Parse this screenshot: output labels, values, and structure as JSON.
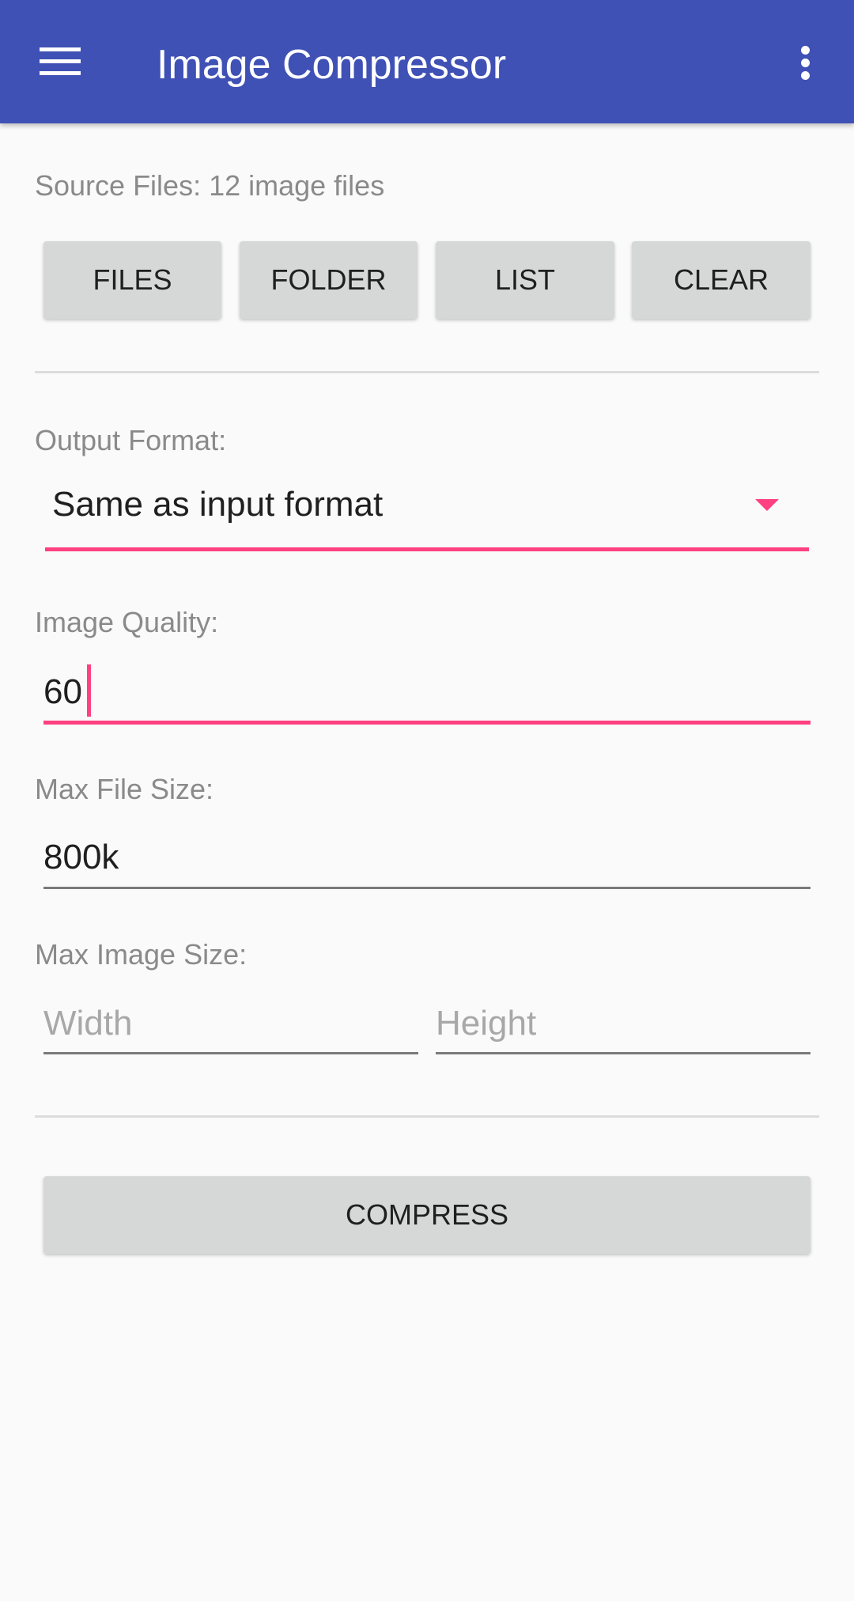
{
  "app_bar": {
    "title": "Image Compressor",
    "menu_icon": "hamburger-menu-icon",
    "overflow_icon": "more-vert-icon",
    "color": "#3f51b5"
  },
  "source": {
    "label": "Source Files: 12 image files",
    "buttons": [
      {
        "label": "FILES"
      },
      {
        "label": "FOLDER"
      },
      {
        "label": "LIST"
      },
      {
        "label": "CLEAR"
      }
    ]
  },
  "output_format": {
    "label": "Output Format:",
    "selected": "Same as input format",
    "arrow_icon": "dropdown-arrow-icon"
  },
  "image_quality": {
    "label": "Image Quality:",
    "value": "60"
  },
  "max_file_size": {
    "label": "Max File Size:",
    "value": "800k"
  },
  "max_image_size": {
    "label": "Max Image Size:",
    "width_placeholder": "Width",
    "height_placeholder": "Height",
    "width_value": "",
    "height_value": ""
  },
  "compress_button": {
    "label": "COMPRESS"
  },
  "accent_color": "#ff4081"
}
